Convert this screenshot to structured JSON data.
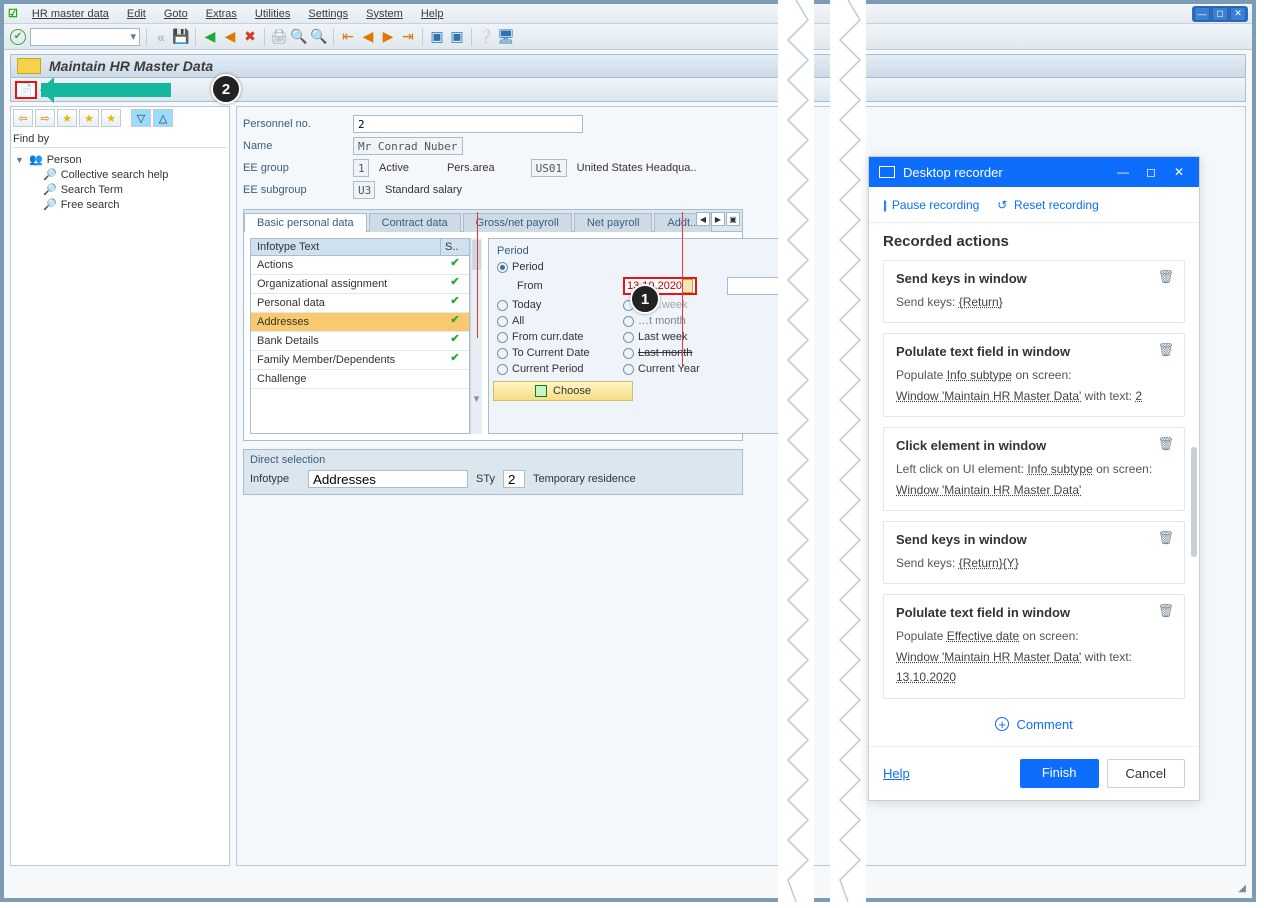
{
  "menu": {
    "items": [
      "HR master data",
      "Edit",
      "Goto",
      "Extras",
      "Utilities",
      "Settings",
      "System",
      "Help"
    ]
  },
  "header": {
    "title": "Maintain HR Master Data"
  },
  "leftpane": {
    "findby": "Find by",
    "tree": [
      {
        "label": "Person",
        "expander": "▼",
        "icon": "👥"
      },
      {
        "label": "Collective search help",
        "indent": 2,
        "icon": "🔎"
      },
      {
        "label": "Search Term",
        "indent": 2,
        "icon": "🔎"
      },
      {
        "label": "Free search",
        "indent": 2,
        "icon": "🔎"
      }
    ]
  },
  "form": {
    "pernr_label": "Personnel no.",
    "pernr": "2",
    "name_label": "Name",
    "name": "Mr Conrad Nuber",
    "eegroup_label": "EE group",
    "eegroup": "1",
    "eegroup_text": "Active",
    "persarea_label": "Pers.area",
    "persarea": "US01",
    "persarea_text": "United States Headqua..",
    "eesub_label": "EE subgroup",
    "eesub": "U3",
    "eesub_text": "Standard salary"
  },
  "tabs": [
    "Basic personal data",
    "Contract data",
    "Gross/net payroll",
    "Net payroll",
    "Addt..."
  ],
  "infotype": {
    "hdr_text": "Infotype Text",
    "hdr_s": "S..",
    "rows": [
      {
        "text": "Actions",
        "chk": true
      },
      {
        "text": "Organizational assignment",
        "chk": true
      },
      {
        "text": "Personal data",
        "chk": true
      },
      {
        "text": "Addresses",
        "chk": true,
        "sel": true
      },
      {
        "text": "Bank Details",
        "chk": true
      },
      {
        "text": "Family Member/Dependents",
        "chk": true
      },
      {
        "text": "Challenge",
        "chk": false
      }
    ]
  },
  "period": {
    "title": "Period",
    "period": "Period",
    "from_label": "From",
    "from": "13.10.2020",
    "to": "",
    "today": "Today",
    "curweek": "Curr.week",
    "all": "All",
    "curmonth": "Current month",
    "fromcurr": "From curr.date",
    "lastweek": "Last week",
    "tocurr": "To Current Date",
    "lastmonth": "Last month",
    "curperiod": "Current Period",
    "curyear": "Current Year",
    "choose": "Choose"
  },
  "direct": {
    "title": "Direct selection",
    "infotype_label": "Infotype",
    "infotype": "Addresses",
    "sty_label": "STy",
    "sty": "2",
    "sty_text": "Temporary residence"
  },
  "recorder": {
    "title": "Desktop recorder",
    "pause": "Pause recording",
    "reset": "Reset recording",
    "section": "Recorded actions",
    "cards": [
      {
        "title": "Send keys in window",
        "lines": [
          [
            "Send keys: ",
            {
              "ul": "{Return}"
            }
          ]
        ]
      },
      {
        "title": "Polulate text field in window",
        "lines": [
          [
            "Populate ",
            {
              "ul": "Info subtype"
            },
            " on screen: "
          ],
          [
            {
              "ul": "Window 'Maintain HR Master Data'"
            },
            " with text: ",
            {
              "ul": "2"
            }
          ]
        ]
      },
      {
        "title": "Click element in window",
        "lines": [
          [
            "Left click on UI element: ",
            {
              "ul": "Info subtype"
            },
            " on screen: "
          ],
          [
            {
              "ul": "Window 'Maintain HR Master Data'"
            }
          ]
        ]
      },
      {
        "title": "Send keys in window",
        "lines": [
          [
            "Send keys: ",
            {
              "ul": "{Return}{Y}"
            }
          ]
        ]
      },
      {
        "title": "Polulate text field in window",
        "lines": [
          [
            "Populate ",
            {
              "ul": "Effective date"
            },
            " on screen: "
          ],
          [
            {
              "ul": "Window 'Maintain HR Master Data'"
            },
            " with text: ",
            {
              "ul": "13.10.2020"
            }
          ]
        ]
      }
    ],
    "comment": "Comment",
    "help": "Help",
    "finish": "Finish",
    "cancel": "Cancel"
  }
}
